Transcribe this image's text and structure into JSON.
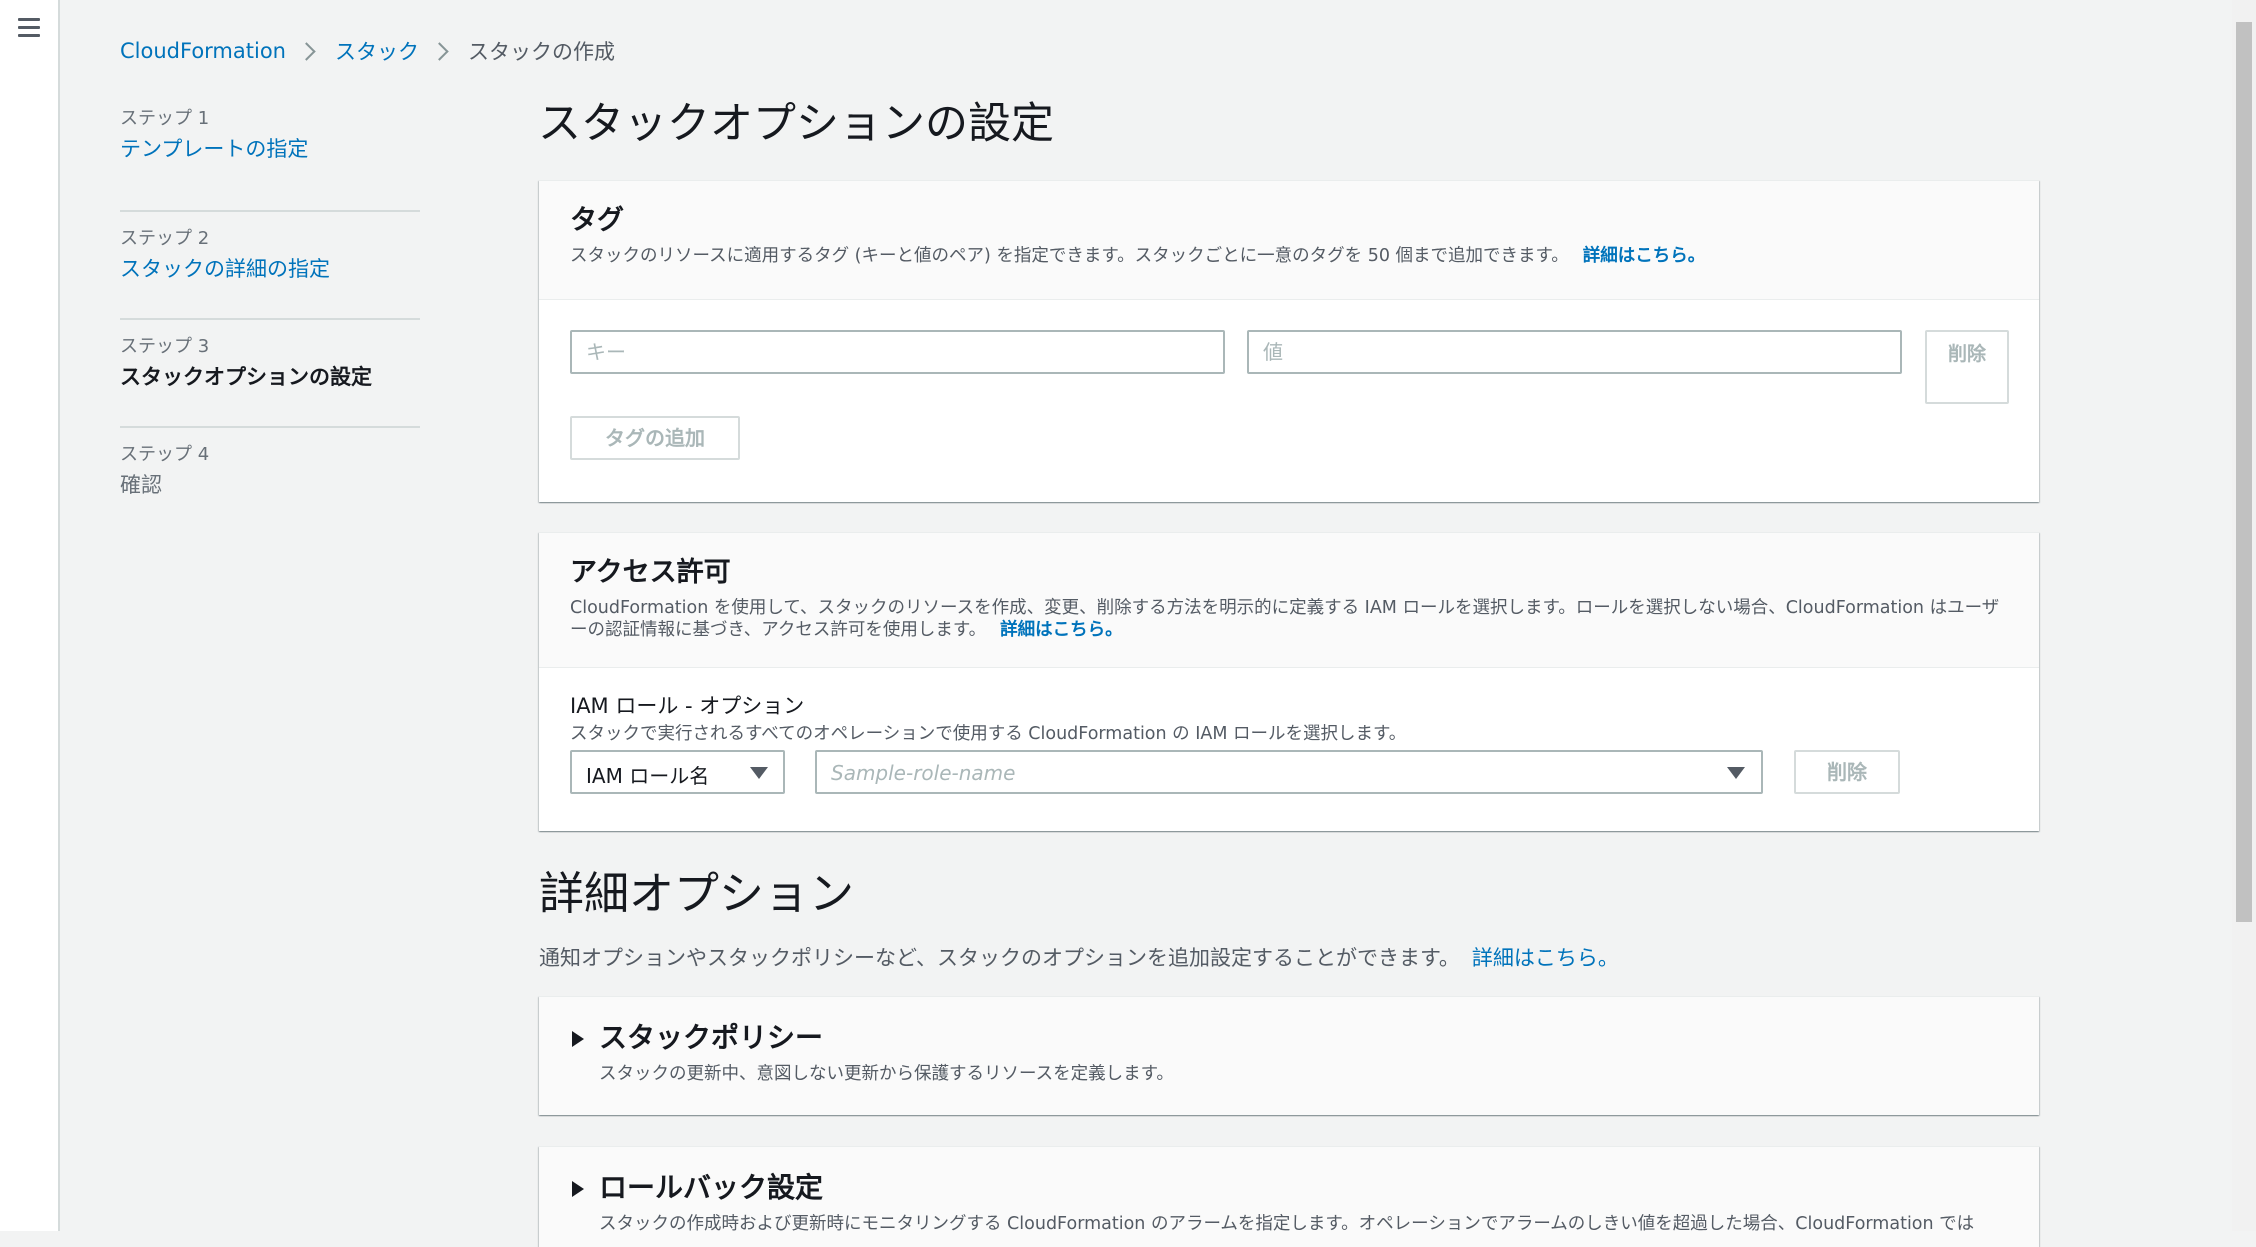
{
  "breadcrumb": {
    "items": [
      "CloudFormation",
      "スタック"
    ],
    "current": "スタックの作成"
  },
  "steps": [
    {
      "num": "ステップ 1",
      "title": "テンプレートの指定"
    },
    {
      "num": "ステップ 2",
      "title": "スタックの詳細の指定"
    },
    {
      "num": "ステップ 3",
      "title": "スタックオプションの設定"
    },
    {
      "num": "ステップ 4",
      "title": "確認"
    }
  ],
  "page_title": "スタックオプションの設定",
  "tags": {
    "title": "タグ",
    "description": "スタックのリソースに適用するタグ (キーと値のペア) を指定できます。スタックごとに一意のタグを 50 個まで追加できます。",
    "info_link": "詳細はこちら。",
    "key_placeholder": "キー",
    "value_placeholder": "値",
    "delete_label": "削除",
    "add_label": "タグの追加"
  },
  "permissions": {
    "title": "アクセス許可",
    "description": "CloudFormation を使用して、スタックのリソースを作成、変更、削除する方法を明示的に定義する IAM ロールを選択します。ロールを選択しない場合、CloudFormation はユーザーの認証情報に基づき、アクセス許可を使用します。",
    "info_link": "詳細はこちら。",
    "role_label": "IAM ロール - オプション",
    "role_desc": "スタックで実行されるすべてのオペレーションで使用する CloudFormation の IAM ロールを選択します。",
    "role_type": "IAM ロール名",
    "role_placeholder": "Sample-role-name",
    "delete_label": "削除"
  },
  "advanced": {
    "title": "詳細オプション",
    "description": "通知オプションやスタックポリシーなど、スタックのオプションを追加設定することができます。",
    "info_link": "詳細はこちら。",
    "sections": [
      {
        "title": "スタックポリシー",
        "description": "スタックの更新中、意図しない更新から保護するリソースを定義します。"
      },
      {
        "title": "ロールバック設定",
        "description": "スタックの作成時および更新時にモニタリングする CloudFormation のアラームを指定します。オペレーションでアラームのしきい値を超過した場合、CloudFormation では"
      }
    ]
  }
}
